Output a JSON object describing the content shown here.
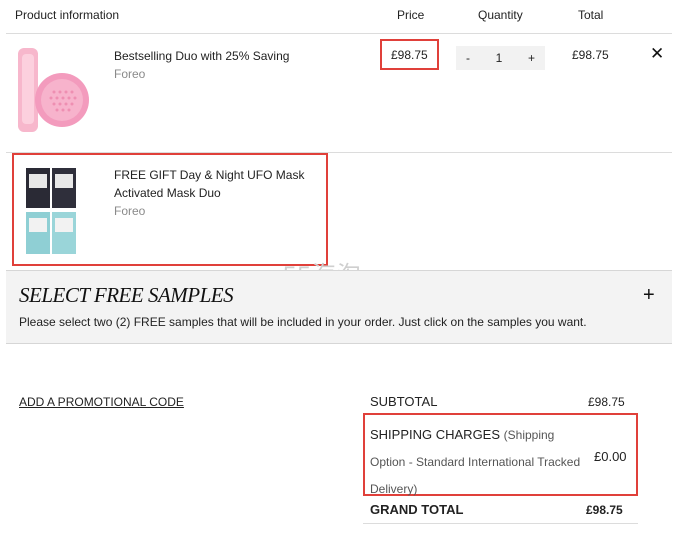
{
  "header": {
    "product_info": "Product information",
    "price": "Price",
    "quantity": "Quantity",
    "total": "Total"
  },
  "items": [
    {
      "name": "Bestselling Duo with 25% Saving",
      "brand": "Foreo",
      "price": "£98.75",
      "quantity": "1",
      "total": "£98.75",
      "minus": "-",
      "plus": "+"
    },
    {
      "name_line1": "FREE GIFT Day & Night UFO Mask",
      "name_line2": "Activated Mask Duo",
      "brand": "Foreo"
    }
  ],
  "watermark": "55海淘",
  "samples": {
    "title": "SELECT FREE SAMPLES",
    "description": "Please select two (2) FREE samples that will be included in your order. Just click on the samples you want.",
    "toggle": "+"
  },
  "promo": {
    "label": "ADD A PROMOTIONAL CODE"
  },
  "summary": {
    "subtotal_label": "SUBTOTAL",
    "subtotal_value": "£98.75",
    "shipping_label": "SHIPPING CHARGES",
    "shipping_detail_1": "(Shipping",
    "shipping_detail_2": "Option - Standard International Tracked",
    "shipping_detail_3": "Delivery)",
    "shipping_value": "£0.00",
    "grand_total_label": "GRAND TOTAL",
    "grand_total_value": "£98.75"
  },
  "colors": {
    "highlight": "#e0403a",
    "device_pink": "#f4a9c2"
  }
}
